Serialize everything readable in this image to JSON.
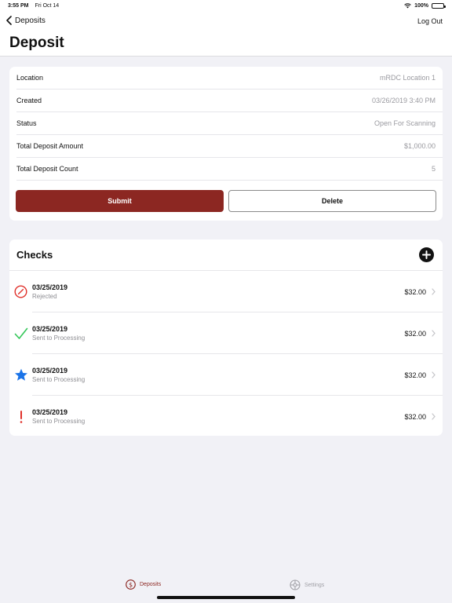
{
  "status_bar": {
    "time": "3:55 PM",
    "date": "Fri Oct 14",
    "battery": "100%"
  },
  "nav": {
    "back_label": "Deposits",
    "logout_label": "Log Out",
    "title": "Deposit"
  },
  "details": [
    {
      "label": "Location",
      "value": "mRDC Location 1"
    },
    {
      "label": "Created",
      "value": "03/26/2019 3:40 PM"
    },
    {
      "label": "Status",
      "value": "Open For Scanning"
    },
    {
      "label": "Total Deposit Amount",
      "value": "$1,000.00"
    },
    {
      "label": "Total Deposit Count",
      "value": "5"
    }
  ],
  "actions": {
    "submit_label": "Submit",
    "delete_label": "Delete"
  },
  "checks": {
    "title": "Checks",
    "items": [
      {
        "date": "03/25/2019",
        "status": "Rejected",
        "amount": "$32.00",
        "icon": "rejected-icon"
      },
      {
        "date": "03/25/2019",
        "status": "Sent to Processing",
        "amount": "$32.00",
        "icon": "checkmark-icon"
      },
      {
        "date": "03/25/2019",
        "status": "Sent to Processing",
        "amount": "$32.00",
        "icon": "star-icon"
      },
      {
        "date": "03/25/2019",
        "status": "Sent to Processing",
        "amount": "$32.00",
        "icon": "exclamation-icon"
      }
    ]
  },
  "tabs": {
    "deposits_label": "Deposits",
    "settings_label": "Settings"
  },
  "colors": {
    "accent": "#8c2722",
    "rejected": "#e0302a",
    "success": "#34c759",
    "star": "#1a73e8",
    "warning": "#e0302a"
  }
}
